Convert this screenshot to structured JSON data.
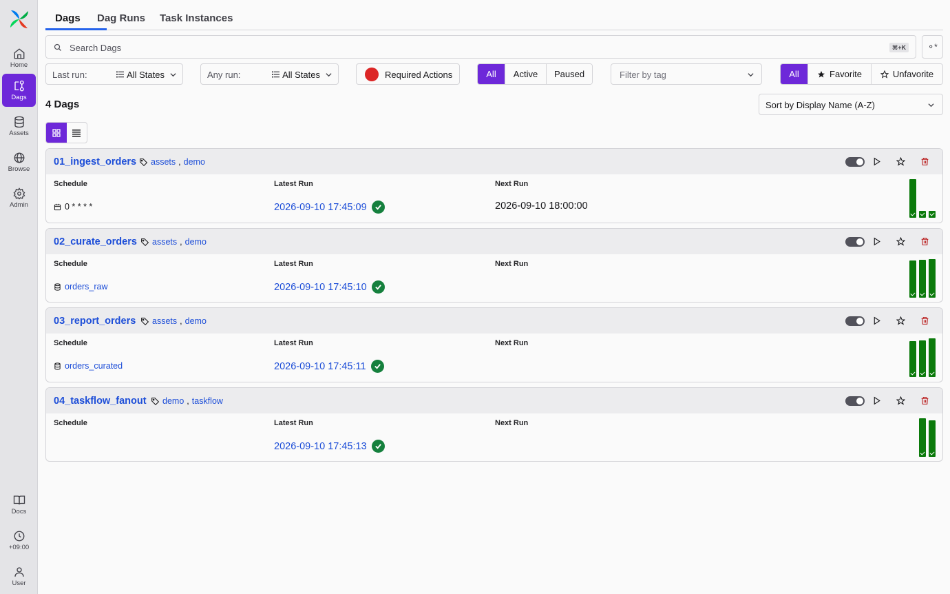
{
  "sidebar": {
    "items": [
      {
        "label": "Home",
        "icon": "home-icon"
      },
      {
        "label": "Dags",
        "icon": "dags-icon"
      },
      {
        "label": "Assets",
        "icon": "database-icon"
      },
      {
        "label": "Browse",
        "icon": "globe-icon"
      },
      {
        "label": "Admin",
        "icon": "gear-icon"
      },
      {
        "label": "Docs",
        "icon": "book-icon"
      },
      {
        "label": "+09:00",
        "icon": "clock-icon"
      },
      {
        "label": "User",
        "icon": "user-icon"
      }
    ]
  },
  "tabs": [
    {
      "label": "Dags",
      "active": true
    },
    {
      "label": "Dag Runs",
      "active": false
    },
    {
      "label": "Task Instances",
      "active": false
    }
  ],
  "search": {
    "placeholder": "Search Dags",
    "shortcut": "⌘+K"
  },
  "filters": {
    "last_run": {
      "label": "Last run:",
      "value": "All States"
    },
    "any_run": {
      "label": "Any run:",
      "value": "All States"
    },
    "required_actions": "Required Actions",
    "state_segments": [
      "All",
      "Active",
      "Paused"
    ],
    "tag_placeholder": "Filter by tag",
    "favorite_segments": [
      "All",
      "Favorite",
      "Unfavorite"
    ]
  },
  "dag_count": "4 Dags",
  "sort_label": "Sort by Display Name (A-Z)",
  "columns": {
    "schedule": "Schedule",
    "latest_run": "Latest Run",
    "next_run": "Next Run"
  },
  "dags": [
    {
      "id": "01_ingest_orders",
      "tags": [
        "assets",
        "demo"
      ],
      "schedule": "0 * * * *",
      "schedule_type": "cron",
      "latest_run": "2026-09-10 17:45:09",
      "next_run": "2026-09-10 18:00:00",
      "run_state": "success"
    },
    {
      "id": "02_curate_orders",
      "tags": [
        "assets",
        "demo"
      ],
      "schedule": "orders_raw",
      "schedule_type": "asset",
      "latest_run": "2026-09-10 17:45:10",
      "next_run": "",
      "run_state": "success"
    },
    {
      "id": "03_report_orders",
      "tags": [
        "assets",
        "demo"
      ],
      "schedule": "orders_curated",
      "schedule_type": "asset",
      "latest_run": "2026-09-10 17:45:11",
      "next_run": "",
      "run_state": "success"
    },
    {
      "id": "04_taskflow_fanout",
      "tags": [
        "demo",
        "taskflow"
      ],
      "schedule": "",
      "schedule_type": "none",
      "latest_run": "2026-09-10 17:45:13",
      "next_run": "",
      "run_state": "success"
    }
  ],
  "colors": {
    "accent": "#6d28d9",
    "link": "#1d4ed8",
    "success": "#0b7a0b",
    "danger": "#b91c1c"
  }
}
